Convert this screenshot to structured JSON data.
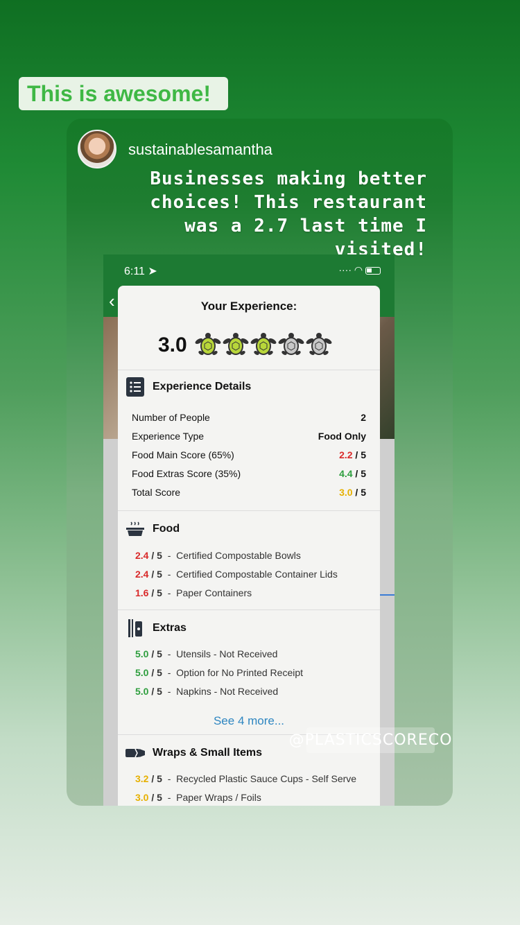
{
  "caption": "This is awesome!",
  "post": {
    "username": "sustainablesamantha",
    "text": "Businesses making better choices! This restaurant was a 2.7 last time I visited!"
  },
  "phone": {
    "time": "6:11",
    "experience_title": "Your Experience:",
    "score": "3.0",
    "turtles_filled": 3,
    "turtles_total": 5,
    "details": {
      "title": "Experience Details",
      "rows": [
        {
          "label": "Number of People",
          "value": "2",
          "suffix": ""
        },
        {
          "label": "Experience Type",
          "value": "Food Only",
          "suffix": ""
        },
        {
          "label": "Food Main Score (65%)",
          "value": "2.2",
          "suffix": " / 5"
        },
        {
          "label": "Food Extras Score (35%)",
          "value": "4.4",
          "suffix": " / 5"
        },
        {
          "label": "Total Score",
          "value": "3.0",
          "suffix": " / 5"
        }
      ]
    },
    "food": {
      "title": "Food",
      "items": [
        {
          "score": "2.4",
          "label": "Certified Compostable Bowls"
        },
        {
          "score": "2.4",
          "label": "Certified Compostable Container Lids"
        },
        {
          "score": "1.6",
          "label": "Paper Containers"
        }
      ]
    },
    "extras": {
      "title": "Extras",
      "items": [
        {
          "score": "5.0",
          "label": "Utensils - Not Received"
        },
        {
          "score": "5.0",
          "label": "Option for No Printed Receipt"
        },
        {
          "score": "5.0",
          "label": "Napkins - Not Received"
        }
      ],
      "see_more": "See 4 more..."
    },
    "wraps": {
      "title": "Wraps & Small Items",
      "items": [
        {
          "score": "3.2",
          "label": "Recycled Plastic Sauce Cups - Self Serve"
        },
        {
          "score": "3.0",
          "label": "Paper Wraps / Foils"
        }
      ]
    },
    "score_suffix": " / 5",
    "score_sep": "  -  "
  },
  "watermark": "@PLASTICSCORECO",
  "colors": {
    "red": "#d92a2a",
    "green": "#2e9e3e",
    "yellow": "#e6b000",
    "link": "#2e86c1"
  },
  "icons": [
    "list-icon",
    "food-container-icon",
    "utensils-icon",
    "wrap-icon",
    "turtle-icon",
    "location-arrow-icon",
    "wifi-icon",
    "battery-icon"
  ]
}
